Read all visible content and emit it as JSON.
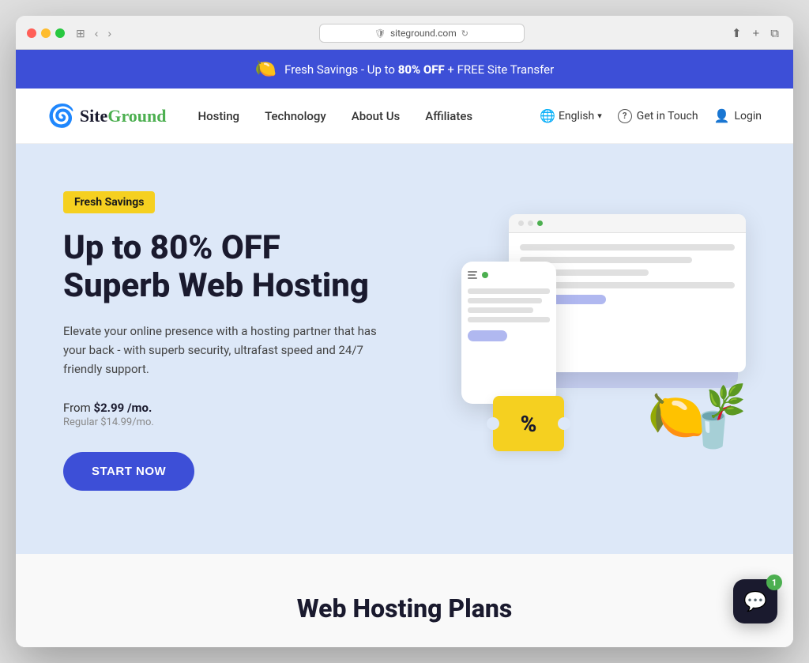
{
  "browser": {
    "url": "siteground.com",
    "shield": "🛡",
    "back_arrow": "‹",
    "forward_arrow": "›",
    "window_icon": "⊞",
    "share_icon": "⬆",
    "plus_icon": "+",
    "tabs_icon": "⧉"
  },
  "promo_banner": {
    "icon": "🍋",
    "text_prefix": "Fresh Savings - Up to ",
    "bold_text": "80% OFF",
    "text_suffix": " + FREE Site Transfer"
  },
  "navbar": {
    "logo_text": "SiteGround",
    "logo_icon": "🌀",
    "nav_items": [
      {
        "label": "Hosting",
        "id": "hosting"
      },
      {
        "label": "Technology",
        "id": "technology"
      },
      {
        "label": "About Us",
        "id": "about-us"
      },
      {
        "label": "Affiliates",
        "id": "affiliates"
      }
    ],
    "language": "English",
    "language_icon": "🌐",
    "contact_label": "Get in Touch",
    "contact_icon": "?",
    "login_label": "Login",
    "login_icon": "👤"
  },
  "hero": {
    "badge_text": "Fresh Savings",
    "title_line1": "Up to 80% OFF",
    "title_line2": "Superb Web Hosting",
    "description": "Elevate your online presence with a hosting partner that has your back - with superb security, ultrafast speed and 24/7 friendly support.",
    "price_from": "From ",
    "price_value": "$2.99 /mo.",
    "price_regular": "Regular $14.99/mo.",
    "cta_button": "START NOW"
  },
  "hosting_plans": {
    "title": "Web Hosting Plans"
  },
  "chat": {
    "badge_count": "1",
    "icon": "💬"
  }
}
